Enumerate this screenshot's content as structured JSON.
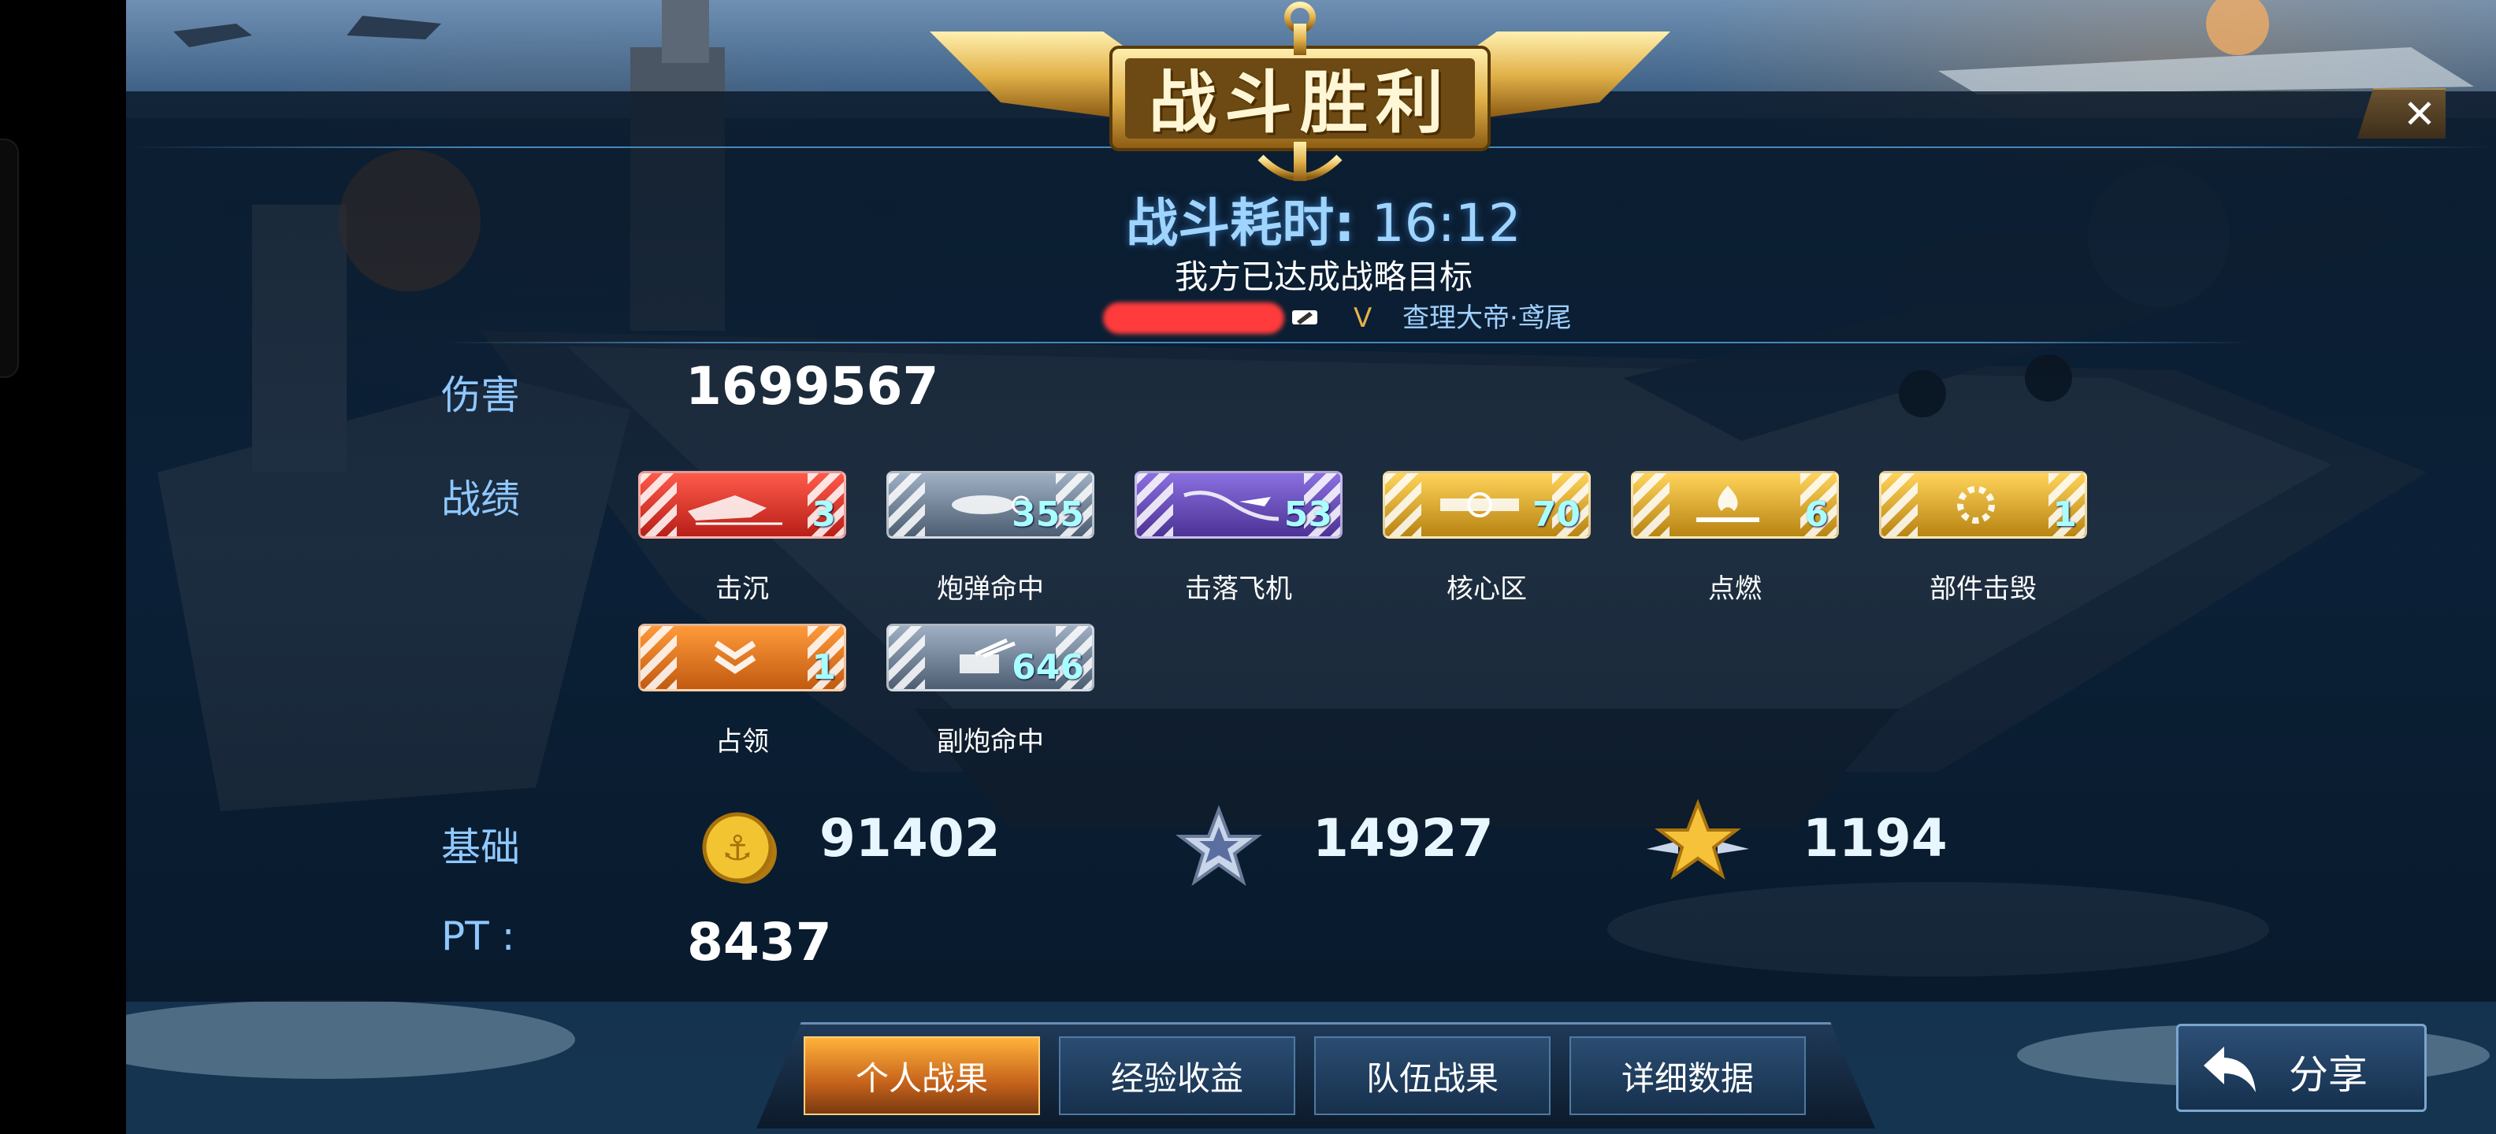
{
  "header": {
    "title": "战斗胜利",
    "close_symbol": "✕"
  },
  "summary": {
    "battle_time_label": "战斗耗时:",
    "battle_time_value": "16:12",
    "objective": "我方已达成战略目标",
    "vip_mark": "V",
    "player_title": "查理大帝·鸢尾"
  },
  "damage": {
    "label": "伤害",
    "value": "1699567"
  },
  "record": {
    "label": "战绩",
    "stats": [
      {
        "name": "击沉",
        "value": "3",
        "icon": "sink-ship-icon",
        "color": "#e0302a"
      },
      {
        "name": "炮弹命中",
        "value": "355",
        "icon": "shell-hit-icon",
        "color": "#6e7f93"
      },
      {
        "name": "击落飞机",
        "value": "53",
        "icon": "plane-down-icon",
        "color": "#6a4fb8"
      },
      {
        "name": "核心区",
        "value": "70",
        "icon": "core-zone-icon",
        "color": "#d9a21f"
      },
      {
        "name": "点燃",
        "value": "6",
        "icon": "ignite-icon",
        "color": "#d9a21f"
      },
      {
        "name": "部件击毁",
        "value": "1",
        "icon": "component-destroy-icon",
        "color": "#d9a21f"
      },
      {
        "name": "占领",
        "value": "1",
        "icon": "capture-chevron-icon",
        "color": "#e07a1a"
      },
      {
        "name": "副炮命中",
        "value": "646",
        "icon": "secondary-gun-icon",
        "color": "#6e7f93"
      }
    ]
  },
  "base": {
    "label": "基础",
    "resources": [
      {
        "value": "91402",
        "icon": "gold-coin-anchor-icon"
      },
      {
        "value": "14927",
        "icon": "silver-star-icon"
      },
      {
        "value": "1194",
        "icon": "gold-winged-star-icon"
      }
    ]
  },
  "pt": {
    "label": "PT :",
    "value": "8437"
  },
  "tabs": [
    {
      "label": "个人战果",
      "active": true
    },
    {
      "label": "经验收益",
      "active": false
    },
    {
      "label": "队伍战果",
      "active": false
    },
    {
      "label": "详细数据",
      "active": false
    }
  ],
  "share_button": {
    "label": "分享"
  }
}
